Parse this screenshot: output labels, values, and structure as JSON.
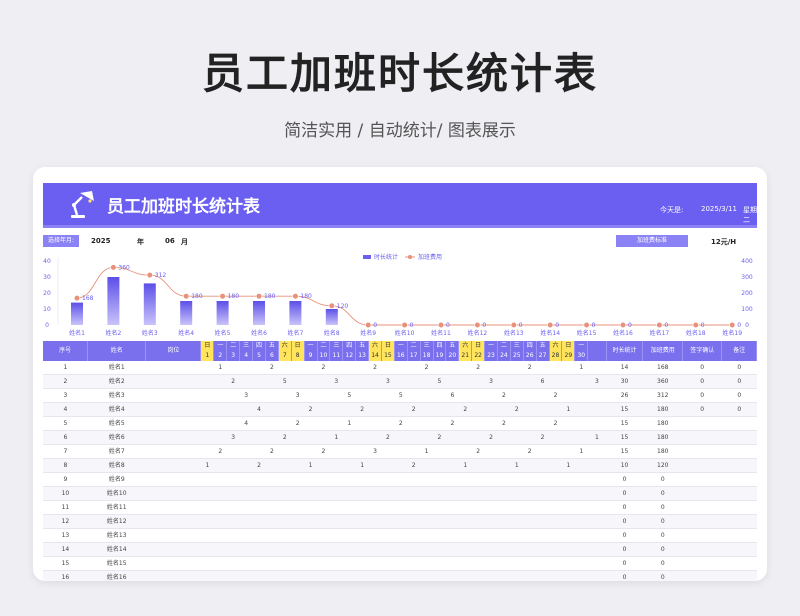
{
  "page": {
    "title": "员工加班时长统计表",
    "subtitle": "简洁实用 / 自动统计/ 图表展示"
  },
  "banner": {
    "title": "员工加班时长统计表",
    "today_label": "今天是:",
    "today_date": "2025/3/11",
    "weekday": "星期二",
    "icon": "desk-lamp-icon"
  },
  "controls": {
    "select_label": "选择年月:",
    "year": "2025",
    "year_unit": "年",
    "month": "06",
    "month_unit": "月",
    "rate_button": "加班费标准",
    "rate_value": "12元/H"
  },
  "colors": {
    "accent": "#6a5ff0",
    "header": "#7a70ee",
    "weekend": "#ffe45c",
    "line": "#e8907a"
  },
  "chart_data": {
    "type": "bar",
    "legend": [
      "时长统计",
      "加班费用"
    ],
    "categories": [
      "姓名1",
      "姓名2",
      "姓名3",
      "姓名4",
      "姓名5",
      "姓名6",
      "姓名7",
      "姓名8",
      "姓名9",
      "姓名10",
      "姓名11",
      "姓名12",
      "姓名13",
      "姓名14",
      "姓名15",
      "姓名16",
      "姓名17",
      "姓名18",
      "姓名19"
    ],
    "series": [
      {
        "name": "时长统计",
        "type": "bar",
        "axis": "left",
        "values": [
          14,
          30,
          26,
          15,
          15,
          15,
          15,
          10,
          0,
          0,
          0,
          0,
          0,
          0,
          0,
          0,
          0,
          0,
          0
        ]
      },
      {
        "name": "加班费用",
        "type": "line",
        "axis": "right",
        "values": [
          168,
          360,
          312,
          180,
          180,
          180,
          180,
          120,
          0,
          0,
          0,
          0,
          0,
          0,
          0,
          0,
          0,
          0,
          0
        ]
      }
    ],
    "y_left_ticks": [
      "40",
      "30",
      "20",
      "10",
      "0"
    ],
    "y_right_ticks": [
      "400",
      "300",
      "200",
      "100",
      "0"
    ],
    "ylim_left": [
      0,
      40
    ],
    "ylim_right": [
      0,
      400
    ]
  },
  "table": {
    "headers": {
      "index": "序号",
      "name": "姓名",
      "post": "岗位",
      "total": "时长统计",
      "fee": "加班费用",
      "sign": "签字确认",
      "note": "备注"
    },
    "weekdays": [
      "日",
      "一",
      "二",
      "三",
      "四",
      "五",
      "六",
      "日",
      "一",
      "二",
      "三",
      "四",
      "五",
      "六",
      "日",
      "一",
      "二",
      "三",
      "四",
      "五",
      "六",
      "日",
      "一",
      "二",
      "三",
      "四",
      "五",
      "六",
      "日",
      "一"
    ],
    "dates": [
      "1",
      "2",
      "3",
      "4",
      "5",
      "6",
      "7",
      "8",
      "9",
      "10",
      "11",
      "12",
      "13",
      "14",
      "15",
      "16",
      "17",
      "18",
      "19",
      "20",
      "21",
      "22",
      "23",
      "24",
      "25",
      "26",
      "27",
      "28",
      "29",
      "30"
    ],
    "weekend_days": [
      1,
      7,
      8,
      14,
      15,
      21,
      22,
      28,
      29
    ],
    "rows": [
      {
        "idx": "1",
        "name": "姓名1",
        "days": {
          "2": "1",
          "6": "2",
          "10": "2",
          "14": "2",
          "18": "2",
          "22": "2",
          "26": "2",
          "30": "1"
        },
        "total": "14",
        "fee": "168",
        "sign": "0",
        "note": "0"
      },
      {
        "idx": "2",
        "name": "姓名2",
        "days": {
          "3": "2",
          "7": "5",
          "11": "3",
          "15": "3",
          "19": "5",
          "23": "3",
          "27": "6",
          "31": "3"
        },
        "total": "30",
        "fee": "360",
        "sign": "0",
        "note": "0"
      },
      {
        "idx": "3",
        "name": "姓名3",
        "days": {
          "4": "3",
          "8": "3",
          "12": "5",
          "16": "5",
          "20": "6",
          "24": "2",
          "28": "2"
        },
        "total": "26",
        "fee": "312",
        "sign": "0",
        "note": "0"
      },
      {
        "idx": "4",
        "name": "姓名4",
        "days": {
          "5": "4",
          "9": "2",
          "13": "2",
          "17": "2",
          "21": "2",
          "25": "2",
          "29": "1"
        },
        "total": "15",
        "fee": "180",
        "sign": "0",
        "note": "0"
      },
      {
        "idx": "5",
        "name": "姓名5",
        "days": {
          "4": "4",
          "8": "2",
          "12": "1",
          "16": "2",
          "20": "2",
          "24": "2",
          "28": "2"
        },
        "total": "15",
        "fee": "180",
        "sign": "",
        "note": ""
      },
      {
        "idx": "6",
        "name": "姓名6",
        "days": {
          "3": "3",
          "7": "2",
          "11": "1",
          "15": "2",
          "19": "2",
          "23": "2",
          "27": "2",
          "31": "1"
        },
        "total": "15",
        "fee": "180",
        "sign": "",
        "note": ""
      },
      {
        "idx": "7",
        "name": "姓名7",
        "days": {
          "2": "2",
          "6": "2",
          "10": "2",
          "14": "3",
          "18": "1",
          "22": "2",
          "26": "2",
          "30": "1"
        },
        "total": "15",
        "fee": "180",
        "sign": "",
        "note": ""
      },
      {
        "idx": "8",
        "name": "姓名8",
        "days": {
          "1": "1",
          "5": "2",
          "9": "1",
          "13": "1",
          "17": "2",
          "21": "1",
          "25": "1",
          "29": "1"
        },
        "total": "10",
        "fee": "120",
        "sign": "",
        "note": ""
      },
      {
        "idx": "9",
        "name": "姓名9",
        "days": {},
        "total": "0",
        "fee": "0",
        "sign": "",
        "note": ""
      },
      {
        "idx": "10",
        "name": "姓名10",
        "days": {},
        "total": "0",
        "fee": "0",
        "sign": "",
        "note": ""
      },
      {
        "idx": "11",
        "name": "姓名11",
        "days": {},
        "total": "0",
        "fee": "0",
        "sign": "",
        "note": ""
      },
      {
        "idx": "12",
        "name": "姓名12",
        "days": {},
        "total": "0",
        "fee": "0",
        "sign": "",
        "note": ""
      },
      {
        "idx": "13",
        "name": "姓名13",
        "days": {},
        "total": "0",
        "fee": "0",
        "sign": "",
        "note": ""
      },
      {
        "idx": "14",
        "name": "姓名14",
        "days": {},
        "total": "0",
        "fee": "0",
        "sign": "",
        "note": ""
      },
      {
        "idx": "15",
        "name": "姓名15",
        "days": {},
        "total": "0",
        "fee": "0",
        "sign": "",
        "note": ""
      },
      {
        "idx": "16",
        "name": "姓名16",
        "days": {},
        "total": "0",
        "fee": "0",
        "sign": "",
        "note": ""
      }
    ]
  }
}
